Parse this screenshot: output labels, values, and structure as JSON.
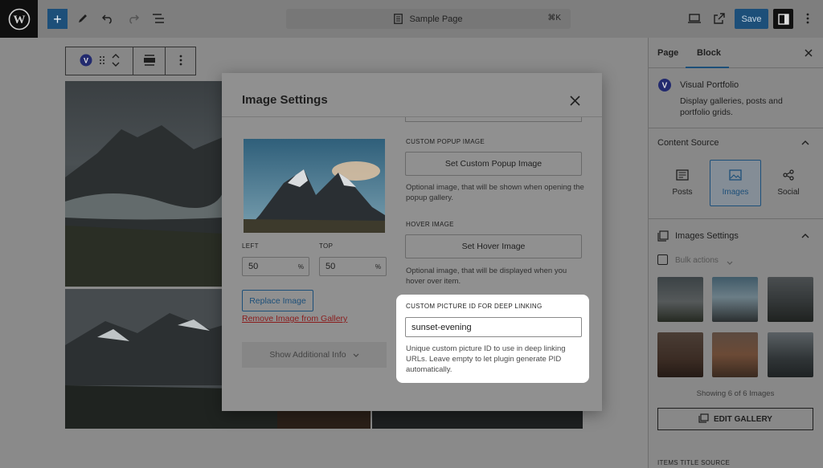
{
  "topbar": {
    "document_title": "Sample Page",
    "shortcut": "⌘K",
    "save_label": "Save"
  },
  "modal": {
    "title": "Image Settings",
    "left_label": "LEFT",
    "left_value": "50",
    "left_unit": "%",
    "top_label": "TOP",
    "top_value": "50",
    "top_unit": "%",
    "replace_image": "Replace Image",
    "remove_image": "Remove Image from Gallery",
    "show_additional_info": "Show Additional Info",
    "custom_popup_label": "CUSTOM POPUP IMAGE",
    "custom_popup_button": "Set Custom Popup Image",
    "custom_popup_help": "Optional image, that will be shown when opening the popup gallery.",
    "hover_label": "HOVER IMAGE",
    "hover_button": "Set Hover Image",
    "hover_help": "Optional image, that will be displayed when you hover over item.",
    "deep_link_label": "CUSTOM PICTURE ID FOR DEEP LINKING",
    "deep_link_value": "sunset-evening",
    "deep_link_help": "Unique custom picture ID to use in deep linking URLs. Leave empty to let plugin generate PID automatically."
  },
  "sidebar": {
    "tabs": [
      "Page",
      "Block"
    ],
    "active_tab": "Block",
    "block_name": "Visual Portfolio",
    "block_description": "Display galleries, posts and portfolio grids.",
    "content_source_title": "Content Source",
    "sources": [
      {
        "label": "Posts",
        "icon": "posts-icon"
      },
      {
        "label": "Images",
        "icon": "images-icon"
      },
      {
        "label": "Social",
        "icon": "social-icon"
      }
    ],
    "active_source": "Images",
    "images_settings_title": "Images Settings",
    "bulk_actions": "Bulk actions",
    "showing_count": "Showing 6 of 6 Images",
    "edit_gallery": "EDIT GALLERY",
    "items_title_source": "ITEMS TITLE SOURCE"
  },
  "colors": {
    "accent": "#1d4f79",
    "overlay_bg": "#8a8a8a",
    "highlight_bg": "#ffffff"
  }
}
